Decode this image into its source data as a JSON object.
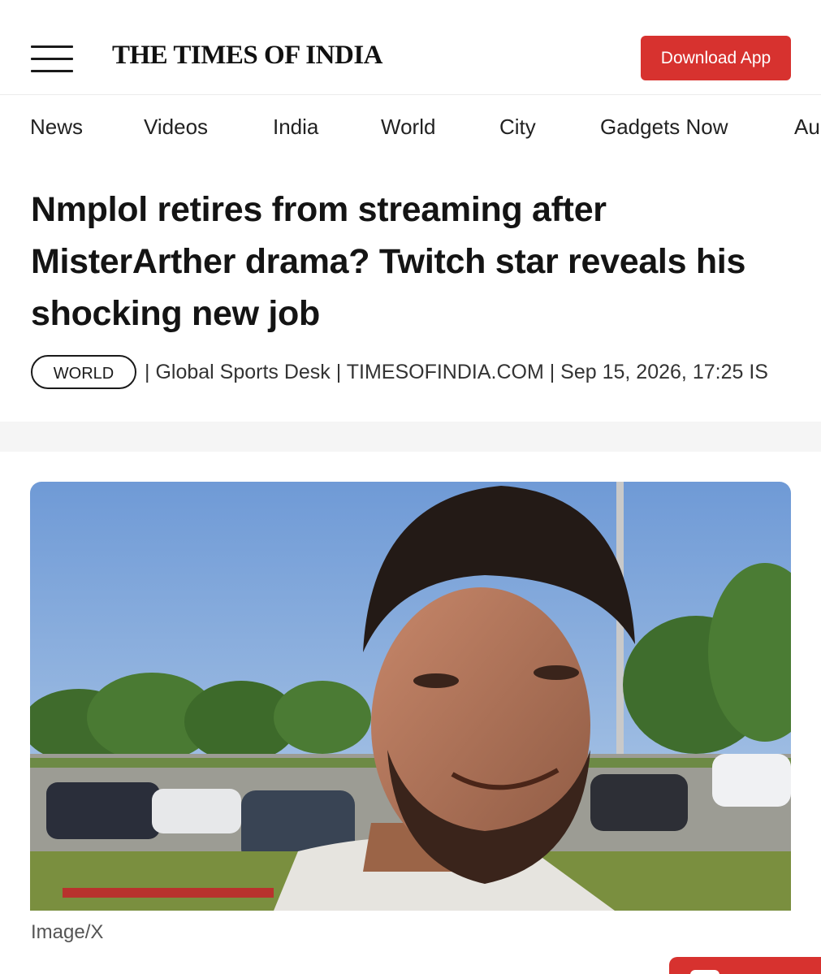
{
  "header": {
    "logo_text": "THE TIMES OF INDIA",
    "download_label": "Download App",
    "accent_color": "#d7322f"
  },
  "nav": {
    "items": [
      {
        "label": "News"
      },
      {
        "label": "Videos"
      },
      {
        "label": "India"
      },
      {
        "label": "World"
      },
      {
        "label": "City"
      },
      {
        "label": "Gadgets Now"
      },
      {
        "label": "Au"
      }
    ]
  },
  "article": {
    "headline": "Nmplol retires from streaming after MisterArther drama? Twitch star reveals his shocking new job",
    "section_tag": "WORLD",
    "meta": "| Global Sports Desk | TIMESOFINDIA.COM | Sep 15, 2026, 17:25 IS",
    "image_caption": "Image/X"
  },
  "icons": {
    "menu": "hamburger-menu-icon"
  }
}
